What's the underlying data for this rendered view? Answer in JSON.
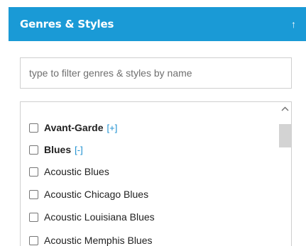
{
  "panel": {
    "title": "Genres & Styles",
    "collapse_glyph": "↑"
  },
  "filter": {
    "value": "",
    "placeholder": "type to filter genres & styles by name"
  },
  "genres": [
    {
      "label": "Avant-Garde",
      "toggle": "[+]",
      "checked": false,
      "is_parent": true
    },
    {
      "label": "Blues",
      "toggle": "[-]",
      "checked": false,
      "is_parent": true
    },
    {
      "label": "Acoustic Blues",
      "checked": false,
      "is_parent": false
    },
    {
      "label": "Acoustic Chicago Blues",
      "checked": false,
      "is_parent": false
    },
    {
      "label": "Acoustic Louisiana Blues",
      "checked": false,
      "is_parent": false
    },
    {
      "label": "Acoustic Memphis Blues",
      "checked": false,
      "is_parent": false
    }
  ],
  "icons": {
    "collapse": "arrow-up-icon",
    "scroll_up": "chevron-up-icon"
  },
  "colors": {
    "header_bg": "#1a9ad6",
    "toggle_link": "#1a8fd0"
  }
}
